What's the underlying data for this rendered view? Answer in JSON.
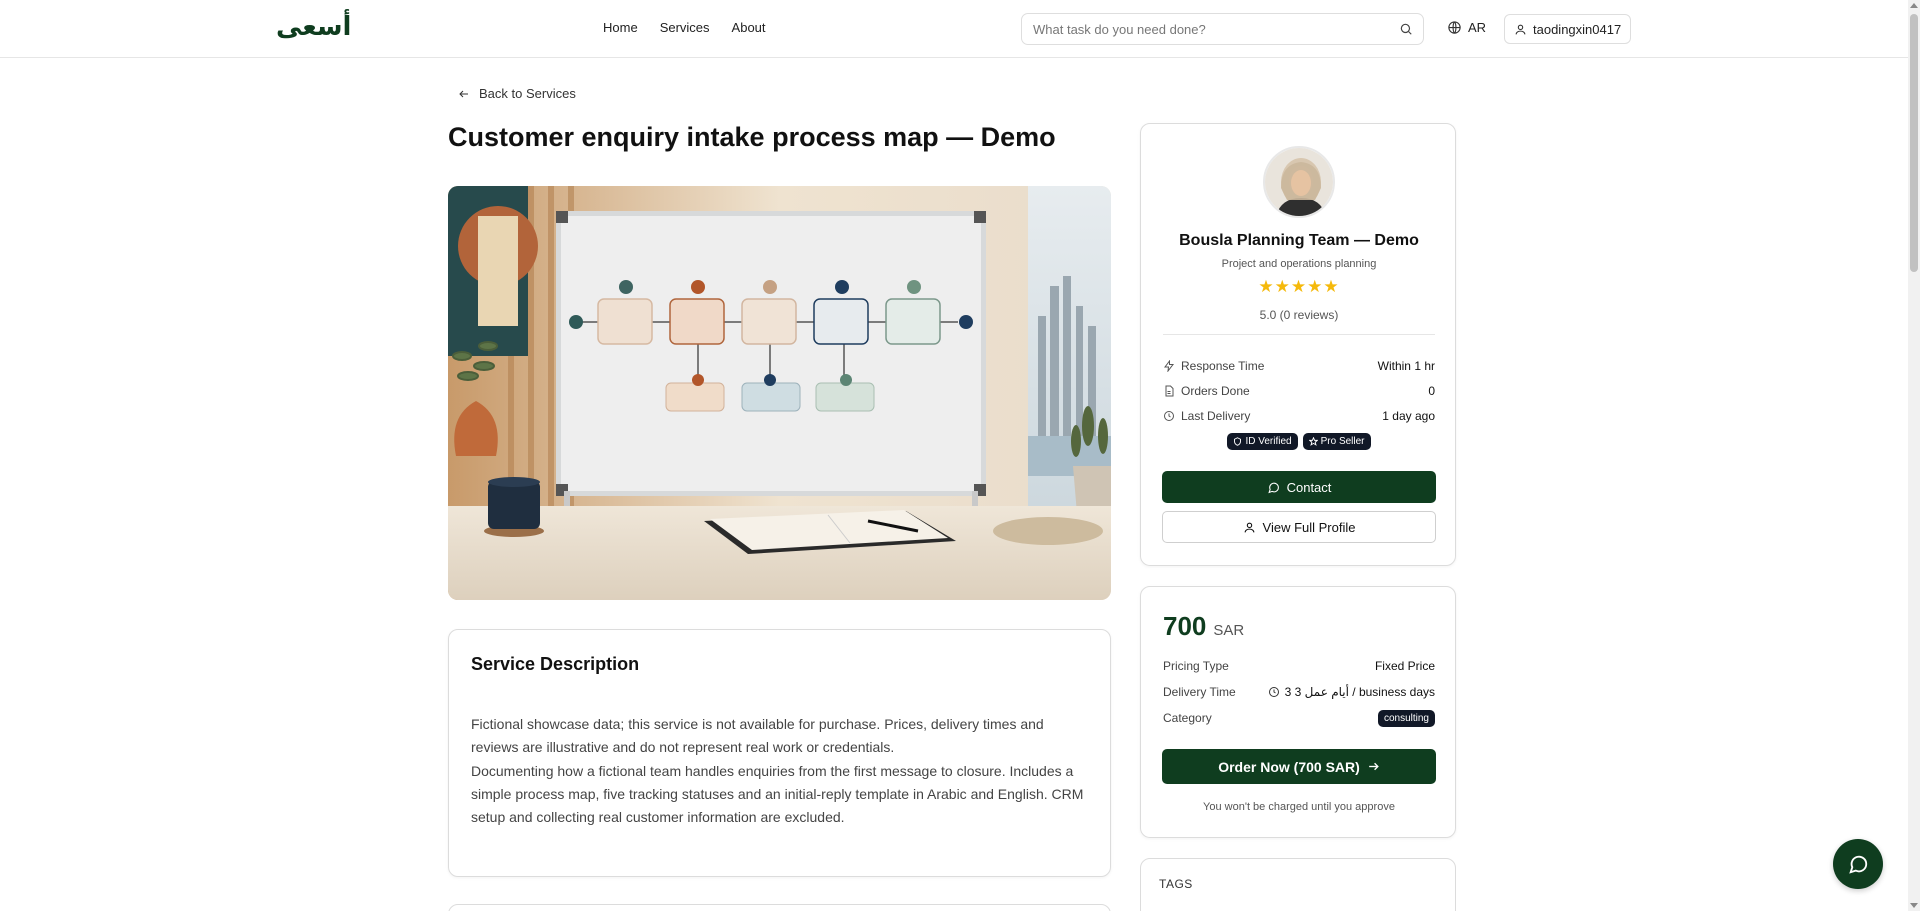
{
  "header": {
    "logo": "أسعى",
    "nav": [
      "Home",
      "Services",
      "About"
    ],
    "search_placeholder": "What task do you need done?",
    "lang": "AR",
    "username": "taodingxin0417"
  },
  "back_label": "Back to Services",
  "title": "Customer enquiry intake process map — Demo",
  "description": {
    "heading": "Service Description",
    "p1": "Fictional showcase data; this service is not available for purchase. Prices, delivery times and reviews are illustrative and do not represent real work or credentials.",
    "p2": "Documenting how a fictional team handles enquiries from the first message to closure. Includes a simple process map, five tracking statuses and an initial-reply template in Arabic and English. CRM setup and collecting real customer information are excluded."
  },
  "seller": {
    "name": "Bousla Planning Team — Demo",
    "subtitle": "Project and operations planning",
    "stars": "★★★★★",
    "rating_value": 5.0,
    "rating": "5.0 (0 reviews)",
    "stats": [
      {
        "label": "Response Time",
        "value": "Within 1 hr",
        "icon": "bolt-icon"
      },
      {
        "label": "Orders Done",
        "value": "0",
        "icon": "document-icon"
      },
      {
        "label": "Last Delivery",
        "value": "1 day ago",
        "icon": "clock-icon"
      }
    ],
    "badges": [
      "ID Verified",
      "Pro Seller"
    ],
    "contact_label": "Contact",
    "profile_label": "View Full Profile"
  },
  "pricing": {
    "amount": "700",
    "currency": "SAR",
    "pricing_type_label": "Pricing Type",
    "pricing_type": "Fixed Price",
    "delivery_label": "Delivery Time",
    "delivery": "3 3 أيام عمل / business days",
    "category_label": "Category",
    "category": "consulting",
    "order_label": "Order Now (700 SAR)",
    "note": "You won't be charged until you approve"
  },
  "tags_label": "TAGS",
  "colors": {
    "brand": "#0f3d1f",
    "badge": "#111827",
    "star": "#f5b90b"
  }
}
